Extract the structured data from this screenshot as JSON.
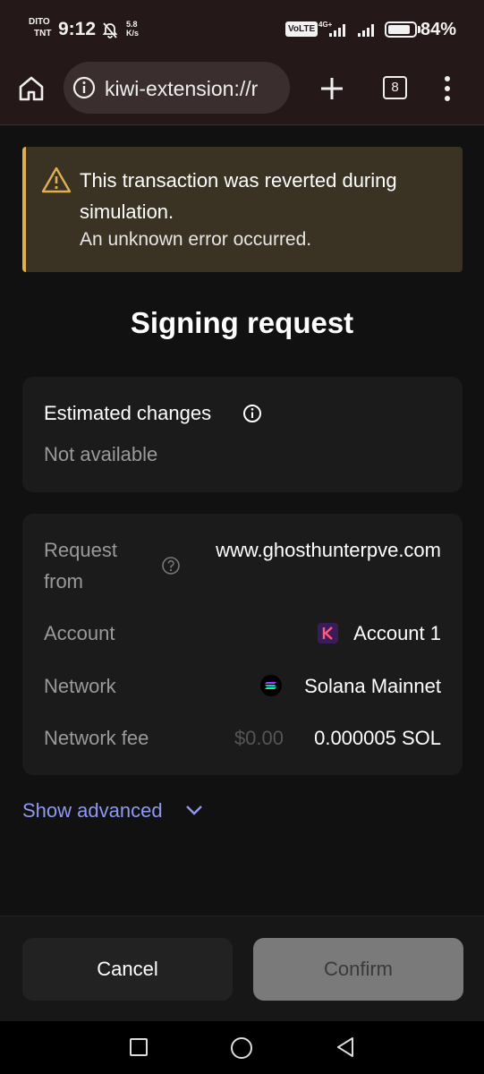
{
  "status_bar": {
    "carrier_line1": "DITO",
    "carrier_line2": "TNT",
    "time": "9:12",
    "speed_value": "5.8",
    "speed_unit": "K/s",
    "volte": "VoLTE",
    "network_type": "4G+",
    "battery_percent": "84%",
    "battery_level": 0.84
  },
  "browser": {
    "url": "kiwi-extension://r",
    "tab_count": "8"
  },
  "warning": {
    "title": "This transaction was reverted during simulation.",
    "message": "An unknown error occurred.",
    "accent_color": "#e0b050"
  },
  "page_title": "Signing request",
  "estimated_changes": {
    "label": "Estimated changes",
    "value": "Not available"
  },
  "details": {
    "request_from_label_line1": "Request",
    "request_from_label_line2": "from",
    "request_from_value": "www.ghosthunterpve.com",
    "account_label": "Account",
    "account_value": "Account 1",
    "network_label": "Network",
    "network_value": "Solana Mainnet",
    "fee_label": "Network fee",
    "fee_usd": "$0.00",
    "fee_value": "0.000005 SOL"
  },
  "show_advanced": "Show advanced",
  "buttons": {
    "cancel": "Cancel",
    "confirm": "Confirm"
  }
}
